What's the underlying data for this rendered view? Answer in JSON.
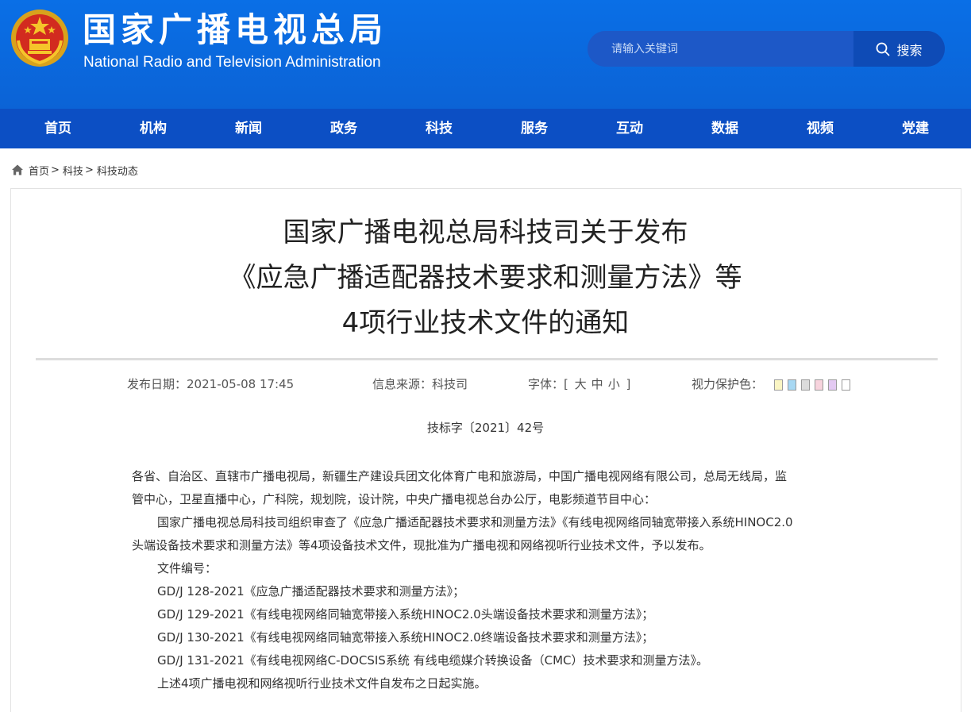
{
  "header": {
    "site_name_cn": "国家广播电视总局",
    "site_name_en": "National Radio and Television Administration"
  },
  "search": {
    "placeholder": "请输入关键词",
    "button_label": "搜索"
  },
  "nav": {
    "items": [
      "首页",
      "机构",
      "新闻",
      "政务",
      "科技",
      "服务",
      "互动",
      "数据",
      "视频",
      "党建"
    ]
  },
  "breadcrumb": {
    "items": [
      "首页",
      "科技",
      "科技动态"
    ],
    "separator": ">"
  },
  "article": {
    "title_lines": [
      "国家广播电视总局科技司关于发布",
      "《应急广播适配器技术要求和测量方法》等",
      "4项行业技术文件的通知"
    ],
    "meta": {
      "date_label": "发布日期：",
      "date_value": "2021-05-08 17:45",
      "source_label": "信息来源：",
      "source_value": "科技司",
      "font_label": "字体：",
      "font_open": "[",
      "font_large": "大",
      "font_medium": "中",
      "font_small": "小",
      "font_close": "]",
      "eye_label": "视力保护色："
    },
    "swatch_colors": [
      "#faf5c3",
      "#a7d8f3",
      "#dcdcdc",
      "#f7d3dd",
      "#e3c9f2",
      "#ffffff"
    ],
    "doc_number": "技标字〔2021〕42号",
    "paragraphs": [
      "各省、自治区、直辖市广播电视局，新疆生产建设兵团文化体育广电和旅游局，中国广播电视网络有限公司，总局无线局，监",
      "管中心，卫星直播中心，广科院，规划院，设计院，中央广播电视总台办公厅，电影频道节目中心：",
      "国家广播电视总局科技司组织审查了《应急广播适配器技术要求和测量方法》《有线电视网络同轴宽带接入系统HINOC2.0",
      "头端设备技术要求和测量方法》等4项设备技术文件，现批准为广播电视和网络视听行业技术文件，予以发布。",
      "文件编号：",
      "GD/J 128-2021《应急广播适配器技术要求和测量方法》；",
      "GD/J 129-2021《有线电视网络同轴宽带接入系统HINOC2.0头端设备技术要求和测量方法》；",
      "GD/J 130-2021《有线电视网络同轴宽带接入系统HINOC2.0终端设备技术要求和测量方法》；",
      "GD/J 131-2021《有线电视网络C-DOCSIS系统 有线电缆媒介转换设备（CMC）技术要求和测量方法》。",
      "上述4项广播电视和网络视听行业技术文件自发布之日起实施。"
    ]
  }
}
